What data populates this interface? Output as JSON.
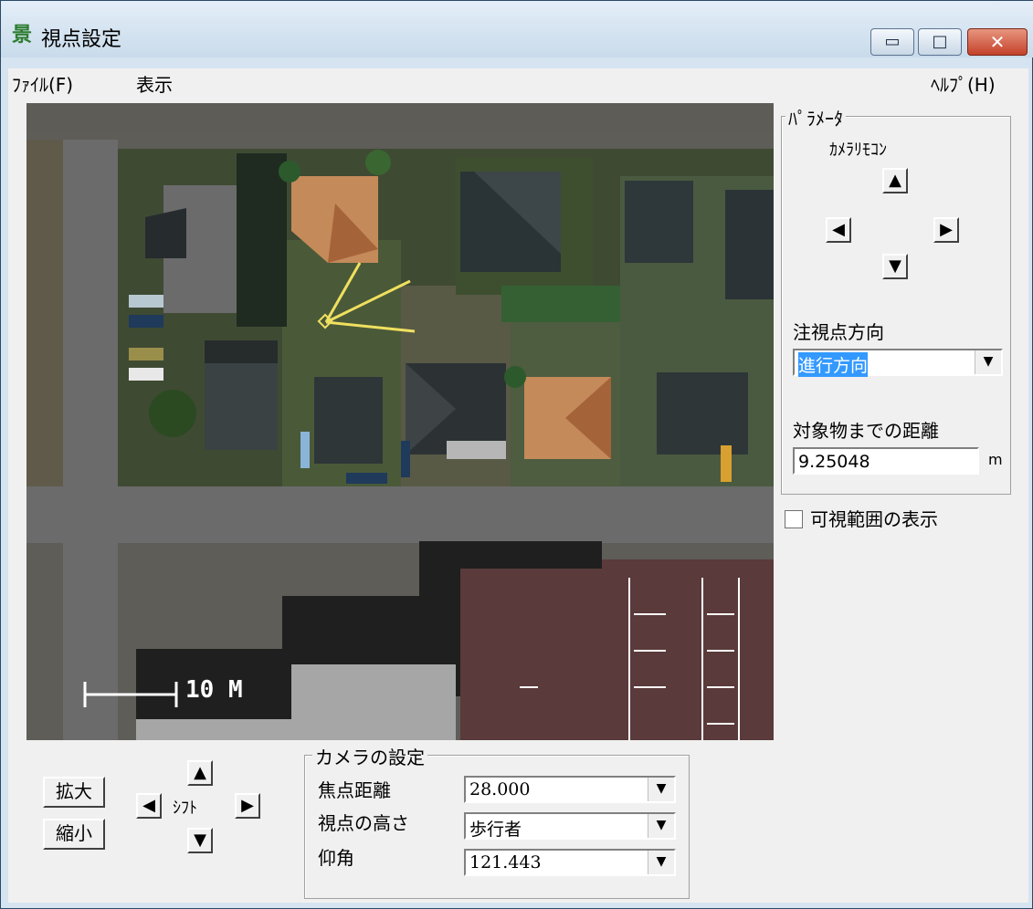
{
  "window": {
    "title": "視点設定"
  },
  "titlebar": {
    "min": "▭",
    "max": "□",
    "close": "✕"
  },
  "menubar": {
    "file": "ﾌｧｲﾙ(F)",
    "view": "表示",
    "help": "ﾍﾙﾌﾟ(H)"
  },
  "map": {
    "scale_label": "10 M"
  },
  "params": {
    "group_title": "ﾊﾟﾗﾒｰﾀ",
    "remote_label": "ｶﾒﾗﾘﾓｺﾝ",
    "up": "▲",
    "left": "◀",
    "right": "▶",
    "down": "▼",
    "gaze_label": "注視点方向",
    "gaze_value": "進行方向",
    "distance_label": "対象物までの距離",
    "distance_value": "9.25048",
    "distance_unit": "m",
    "visible_range_label": "可視範囲の表示"
  },
  "zoom": {
    "in_label": "拡大",
    "out_label": "縮小"
  },
  "shift": {
    "label": "ｼﾌﾄ",
    "up": "▲",
    "left": "◀",
    "right": "▶",
    "down": "▼"
  },
  "camera": {
    "group_title": "カメラの設定",
    "focal_label": "焦点距離",
    "focal_value": "28.000",
    "height_label": "視点の高さ",
    "height_value": "歩行者",
    "elevation_label": "仰角",
    "elevation_value": "121.443"
  },
  "icons": {
    "combo_arrow": "▼"
  },
  "colors": {
    "titlebar": "#d6e4f1",
    "close": "#c4412a",
    "selection": "#3399ff"
  }
}
